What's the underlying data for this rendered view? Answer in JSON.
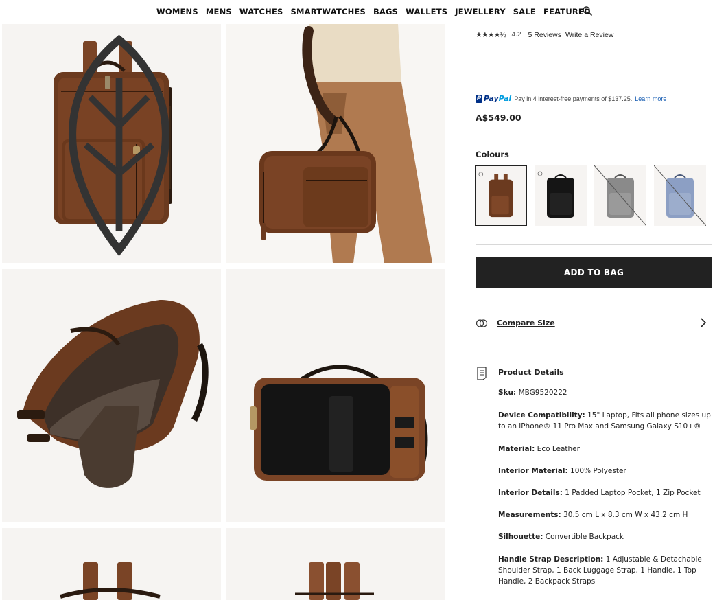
{
  "nav": {
    "items": [
      "WOMENS",
      "MENS",
      "WATCHES",
      "SMARTWATCHES",
      "BAGS",
      "WALLETS",
      "JEWELLERY",
      "SALE",
      "FEATURED"
    ],
    "search_icon": "search-icon"
  },
  "gallery": {
    "badge_icon": "eco-leaf-icon"
  },
  "rating": {
    "stars": "★★★★½",
    "value": "4.2",
    "reviews_link": "5 Reviews",
    "write_link": "Write a Review"
  },
  "paypal": {
    "logo_text": "Pay",
    "logo_text2": "Pal",
    "message": "Pay in 4 interest-free payments of $137.25.",
    "learn_more": "Learn more"
  },
  "price": "A$549.00",
  "colours": {
    "label": "Colours",
    "swatches": [
      {
        "name": "Brown",
        "selected": true,
        "available": true
      },
      {
        "name": "Black",
        "selected": false,
        "available": true
      },
      {
        "name": "Grey",
        "selected": false,
        "available": false
      },
      {
        "name": "Blue",
        "selected": false,
        "available": false
      }
    ]
  },
  "add_to_bag": "ADD TO BAG",
  "compare": {
    "label": "Compare Size",
    "icon": "compare-rings-icon"
  },
  "product_details": {
    "title": "Product Details",
    "icon": "document-icon",
    "rows": [
      {
        "label": "Sku:",
        "value": " MBG9520222"
      },
      {
        "label": "Device Compatibility:",
        "value": " 15\" Laptop, Fits all phone sizes up to an iPhone® 11 Pro Max and Samsung Galaxy S10+®"
      },
      {
        "label": "Material:",
        "value": " Eco Leather"
      },
      {
        "label": "Interior Material:",
        "value": " 100% Polyester"
      },
      {
        "label": "Interior Details:",
        "value": " 1 Padded Laptop Pocket, 1 Zip Pocket"
      },
      {
        "label": "Measurements:",
        "value": " 30.5 cm L x 8.3 cm W x 43.2 cm H"
      },
      {
        "label": "Silhouette:",
        "value": " Convertible Backpack"
      },
      {
        "label": "Handle Strap Description:",
        "value": " 1 Adjustable & Detachable Shoulder Strap, 1 Back Luggage Strap, 1 Handle, 1 Top Handle, 2 Backpack Straps"
      }
    ]
  },
  "colors": {
    "leather": "#6b3a1f",
    "leather_light": "#8a5030",
    "button_bg": "#222222",
    "tile_bg": "#f6f4f2",
    "paypal_blue": "#003087",
    "paypal_light": "#009cde"
  }
}
